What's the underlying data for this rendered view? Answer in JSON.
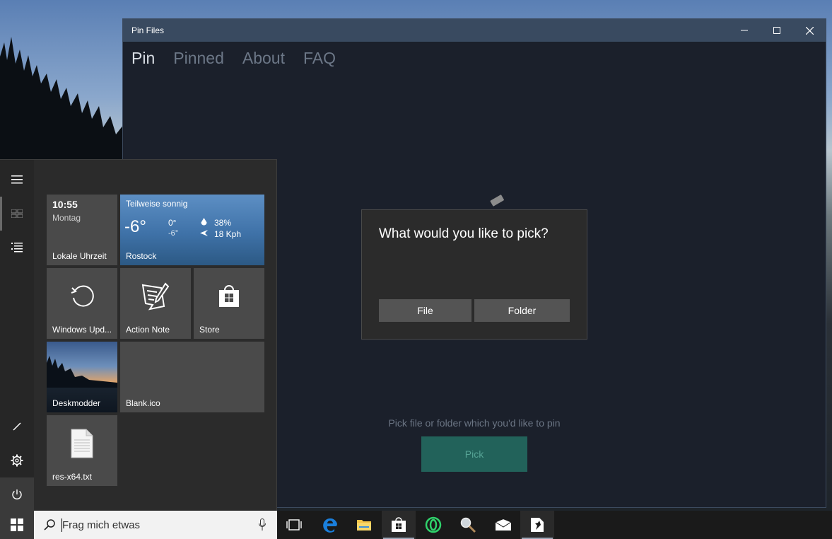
{
  "window": {
    "title": "Pin Files",
    "nav_tabs": [
      {
        "label": "Pin"
      },
      {
        "label": "Pinned"
      },
      {
        "label": "About"
      },
      {
        "label": "FAQ"
      }
    ],
    "hint": "Pick file or folder which you'd like to pin",
    "pick_label": "Pick"
  },
  "dialog": {
    "title": "What would you like to pick?",
    "file_label": "File",
    "folder_label": "Folder"
  },
  "start_menu": {
    "clock": {
      "time": "10:55",
      "day": "Montag",
      "label": "Lokale Uhrzeit"
    },
    "weather": {
      "condition": "Teilweise sonnig",
      "temp": "-6°",
      "high": "0°",
      "low": "-6°",
      "humidity": "38%",
      "wind": "18 Kph",
      "city": "Rostock"
    },
    "tiles": [
      {
        "label": "Windows Upd..."
      },
      {
        "label": "Action Note"
      },
      {
        "label": "Store"
      },
      {
        "label": "Deskmodder"
      },
      {
        "label": "Blank.ico"
      },
      {
        "label": "res-x64.txt"
      }
    ]
  },
  "taskbar": {
    "search_placeholder": "Frag mich etwas"
  },
  "colors": {
    "accent": "#22625a",
    "titlebar": "#394a60",
    "window_bg": "#1b202b"
  }
}
